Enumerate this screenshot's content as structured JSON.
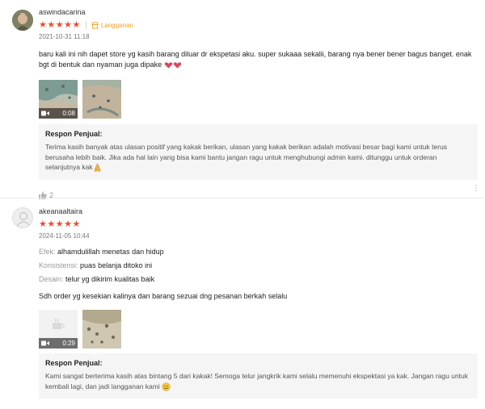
{
  "reviews": [
    {
      "username": "aswindacarina",
      "stars": "★★★★★",
      "badge": "Langganan",
      "date": "2021-10-31 11:18",
      "comment": "baru kali ini nih dapet store yg kasih barang diluar dr ekspetasi aku. super sukaaa sekalii, barang nya bener bener bagus banget. enak bgt di bentuk dan nyaman juga dipake",
      "video_duration": "0:08",
      "seller_title": "Respon Penjual:",
      "seller_text": "Terima kasih banyak atas ulasan positif yang kakak berikan, ulasan yang kakak berikan adalah motivasi besar bagi kami untuk terus berusaha lebih baik. Jika ada hal lain yang bisa kami bantu jangan ragu untuk menghubungi admin kami. ditunggu untuk orderan selanjutnya kak",
      "likes": "2"
    },
    {
      "username": "akeanaaltaira",
      "stars": "★★★★★",
      "date": "2024-11-05 10:44",
      "attributes": [
        {
          "label": "Efek:",
          "value": "alhamdulillah menetas dan hidup"
        },
        {
          "label": "Konsistensi:",
          "value": "puas belanja ditoko ini"
        },
        {
          "label": "Desain:",
          "value": "telur yg dikirim kualitas baik"
        }
      ],
      "comment": "Sdh order yg kesekian kalinya dan barang sezuai dng pesanan berkah selalu",
      "video_duration": "0:29",
      "seller_title": "Respon Penjual:",
      "seller_text": "Kami sangat berterima kasih atas bintang 5 dari kakak! Semoga telur jangkrik kami selalu memenuhi ekspektasi ya kak. Jangan ragu untuk kembali lagi, dan jadi langganan kami"
    }
  ],
  "colors": {
    "star": "#ee4d2d",
    "badge": "#f0a020",
    "seller_bg": "#f5f5f5"
  },
  "icons": [
    "avatar",
    "star-icon",
    "shop-badge-icon",
    "video-camera-icon",
    "heart-emoji",
    "pray-emoji",
    "smile-emoji",
    "thumbs-up-icon",
    "more-options-icon",
    "cup-placeholder-icon"
  ]
}
